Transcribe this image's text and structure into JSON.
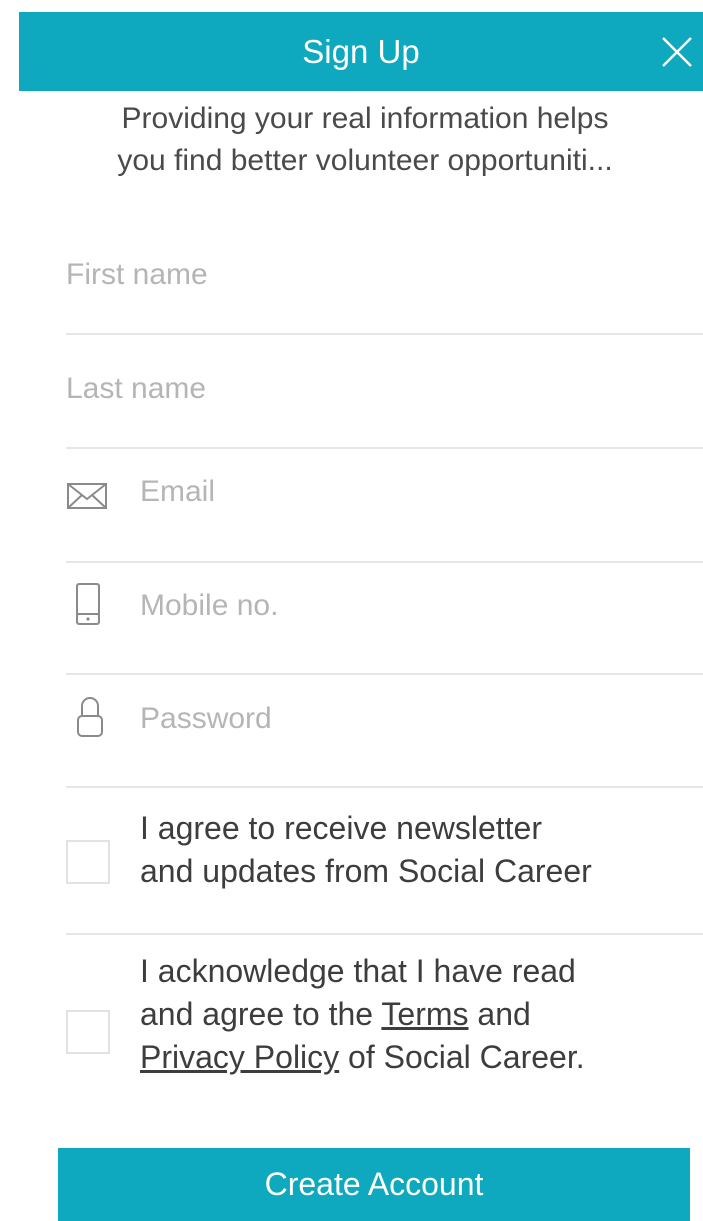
{
  "header": {
    "title": "Sign Up",
    "close_icon": "close-icon"
  },
  "intro": {
    "line1": "Providing your real information helps",
    "line2": "you find better volunteer opportuniti..."
  },
  "form": {
    "first_name_placeholder": "First name",
    "last_name_placeholder": "Last name",
    "email_placeholder": "Email",
    "email_icon": "envelope-icon",
    "mobile_placeholder": "Mobile no.",
    "mobile_icon": "phone-icon",
    "password_placeholder": "Password",
    "password_icon": "lock-icon"
  },
  "consent": {
    "newsletter_line1": "I agree to receive newsletter",
    "newsletter_line2": "and updates from Social Career",
    "terms_line1": "I acknowledge that I have read",
    "terms_prefix": "and agree to the ",
    "terms_link": "Terms",
    "terms_and": " and",
    "privacy_link": "Privacy Policy",
    "terms_suffix": " of Social Career."
  },
  "cta": {
    "label": "Create Account"
  },
  "colors": {
    "accent": "#0ea8bf",
    "placeholder": "#b5b5b5",
    "text": "#3d3d3d",
    "divider": "#e6e6e6"
  }
}
